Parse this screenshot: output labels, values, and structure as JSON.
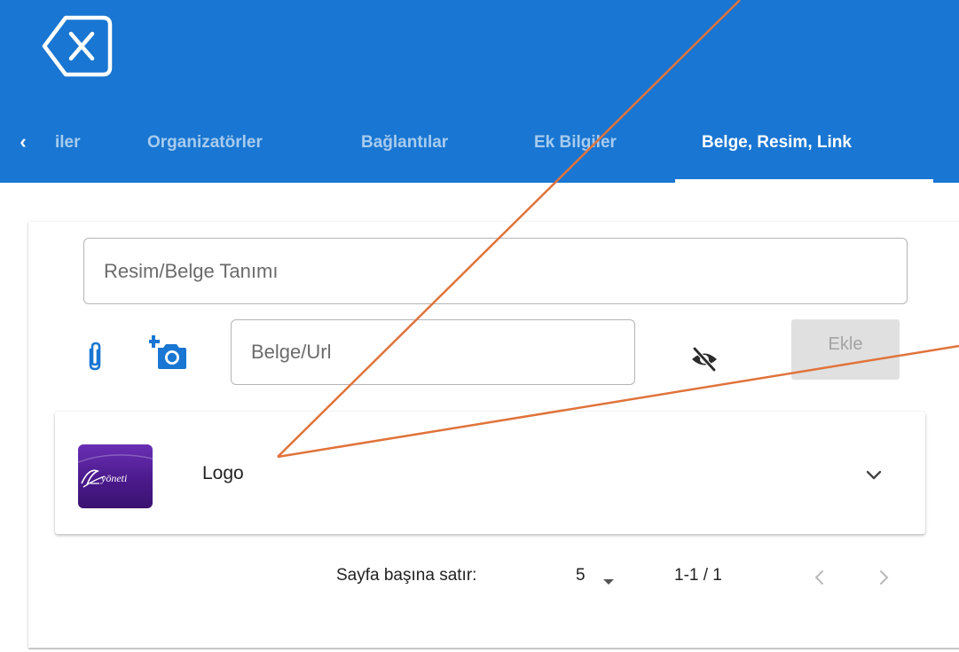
{
  "header": {
    "tabs": [
      {
        "label": "iler",
        "active": false
      },
      {
        "label": "Organizatörler",
        "active": false
      },
      {
        "label": "Bağlantılar",
        "active": false
      },
      {
        "label": "Ek Bilgiler",
        "active": false
      },
      {
        "label": "Belge, Resim, Link",
        "active": true
      }
    ],
    "scroll_left_glyph": "‹"
  },
  "form": {
    "description_placeholder": "Resim/Belge Tanımı",
    "url_placeholder": "Belge/Url",
    "add_label": "Ekle"
  },
  "items": [
    {
      "label": "Logo",
      "thumbnail_text": "yöneti"
    }
  ],
  "pagination": {
    "rows_label": "Sayfa başına satır:",
    "rows_value": "5",
    "range_text": "1-1 / 1"
  },
  "icons": {
    "close": "backspace-x-icon",
    "attach": "paperclip-icon",
    "camera": "add-camera-icon",
    "visibility": "eye-off-icon",
    "expand": "chevron-down-icon",
    "dropdown": "caret-down-icon",
    "prev": "chevron-left-icon",
    "next": "chevron-right-icon"
  },
  "colors": {
    "primary": "#1976d2",
    "annotation_arrow": "#e0733a"
  }
}
